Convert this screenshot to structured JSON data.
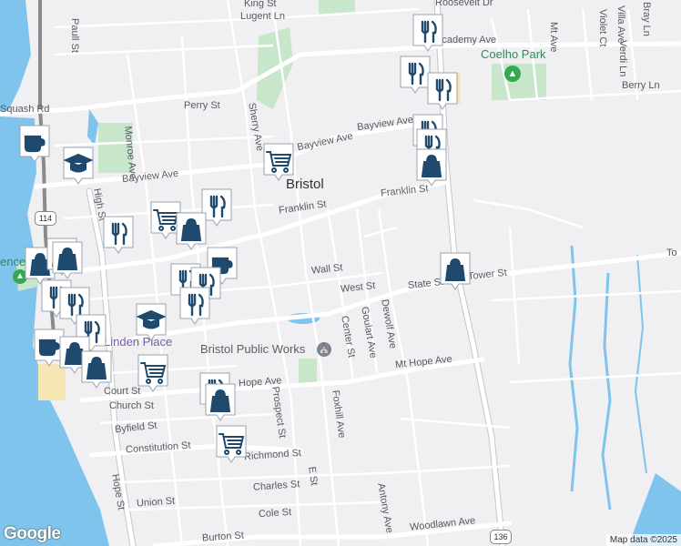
{
  "map": {
    "attribution": "Map data ©2025",
    "logo_text": "Google",
    "colors": {
      "land": "#f0eff2",
      "water": "#7fc4ec",
      "park": "#c8e6c9",
      "road": "#ffffff",
      "highway": "#c4c7cc",
      "rail": "#8a8a8a",
      "marker": "#1f4a6e",
      "marker_bg": "#ffffff"
    },
    "town_label": "Bristol",
    "street_labels": [
      "King St",
      "Lugent Ln",
      "Roosevelt Dr",
      "Paull St",
      "Academy Ave",
      "Mt Ave",
      "Villa Ave",
      "Bray Ln",
      "Violet Ct",
      "Verdi Ln",
      "Berry Ln",
      "Perry St",
      "Bayview Ave",
      "Bayview Ave",
      "Sherry Ave",
      "Monroe Ave",
      "Bayview Ave",
      "Franklin St",
      "Franklin St",
      "High St",
      "Wall St",
      "West St",
      "State St",
      "Tower St",
      "Center St",
      "Goulart Ave",
      "Dewolf Ave",
      "Mt Hope Ave",
      "Hope Ave",
      "Court St",
      "Church St",
      "Byfield St",
      "Prospect St",
      "Foxhill Ave",
      "Constitution St",
      "Richmond St",
      "Charles St",
      "E St",
      "Union St",
      "Cole St",
      "Antony Ave",
      "Burton St",
      "Woodlawn Ave",
      "Hope St",
      "Squash Rd",
      "To"
    ],
    "poi_labels": {
      "public_works": "Bristol Public Works",
      "linden_place": "Linden Place",
      "coelho_park": "Coelho Park",
      "park_fragment": "ence"
    },
    "route_shields": [
      "114",
      "136"
    ],
    "markers": [
      {
        "type": "restaurant"
      },
      {
        "type": "restaurant"
      },
      {
        "type": "restaurant"
      },
      {
        "type": "restaurant"
      },
      {
        "type": "restaurant"
      },
      {
        "type": "shopping"
      },
      {
        "type": "cafe"
      },
      {
        "type": "school"
      },
      {
        "type": "grocery"
      },
      {
        "type": "restaurant"
      },
      {
        "type": "restaurant"
      },
      {
        "type": "grocery"
      },
      {
        "type": "shopping"
      },
      {
        "type": "cafe"
      },
      {
        "type": "restaurant"
      },
      {
        "type": "restaurant"
      },
      {
        "type": "restaurant"
      },
      {
        "type": "shopping"
      },
      {
        "type": "shopping"
      },
      {
        "type": "shopping"
      },
      {
        "type": "restaurant"
      },
      {
        "type": "restaurant"
      },
      {
        "type": "restaurant"
      },
      {
        "type": "school"
      },
      {
        "type": "cafe"
      },
      {
        "type": "shopping"
      },
      {
        "type": "shopping"
      },
      {
        "type": "grocery"
      },
      {
        "type": "restaurant"
      },
      {
        "type": "shopping"
      },
      {
        "type": "grocery"
      },
      {
        "type": "shopping"
      }
    ]
  }
}
